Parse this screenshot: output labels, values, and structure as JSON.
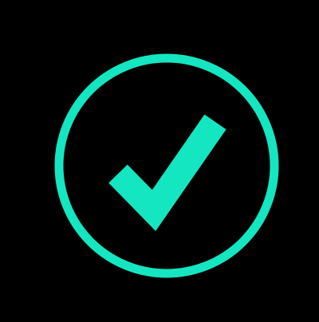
{
  "status": {
    "icon": "check-circle-icon",
    "state": "success"
  },
  "colors": {
    "background": "#000000",
    "accent": "#14E6C1"
  }
}
